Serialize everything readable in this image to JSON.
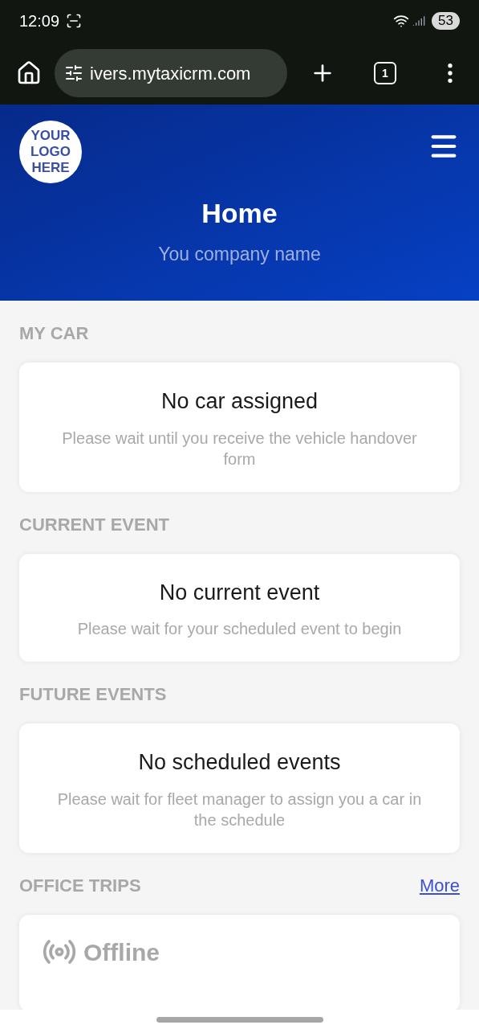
{
  "status_bar": {
    "time": "12:09",
    "battery": "53"
  },
  "browser": {
    "url": "ivers.mytaxicrm.com",
    "tab_count": "1"
  },
  "header": {
    "logo_lines": [
      "YOUR",
      "LOGO",
      "HERE"
    ],
    "title": "Home",
    "subtitle": "You company name"
  },
  "sections": [
    {
      "kind": "message",
      "title": "MY CAR",
      "card_title": "No car assigned",
      "card_text": "Please wait until you receive the vehicle handover form"
    },
    {
      "kind": "message",
      "title": "CURRENT EVENT",
      "card_title": "No current event",
      "card_text": "Please wait for your scheduled event to begin"
    },
    {
      "kind": "message",
      "title": "FUTURE EVENTS",
      "card_title": "No scheduled events",
      "card_text": "Please wait for fleet manager to assign you a car in the schedule"
    },
    {
      "kind": "status",
      "title": "OFFICE TRIPS",
      "link": "More",
      "status": "Offline"
    }
  ]
}
